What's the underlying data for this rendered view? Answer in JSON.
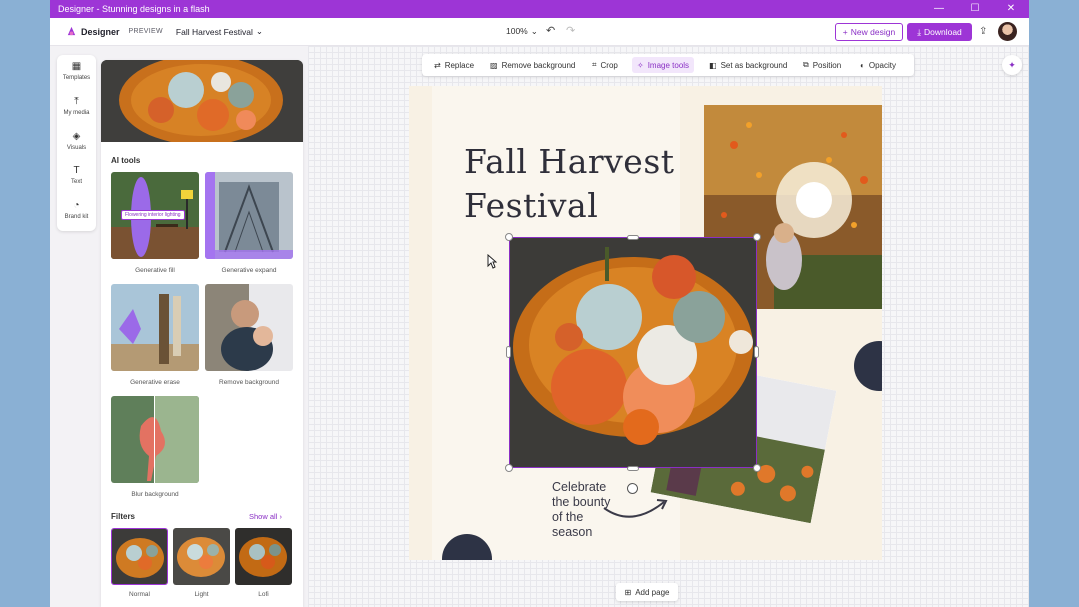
{
  "window": {
    "title": "Designer - Stunning designs in a flash",
    "controls": [
      "—",
      "☐",
      "✕"
    ]
  },
  "header": {
    "brand": "Designer",
    "preview_tag": "PREVIEW",
    "doc_name": "Fall Harvest Festival",
    "zoom": "100%",
    "new_design": "New design",
    "download": "Download"
  },
  "rail": {
    "items": [
      {
        "label": "Templates",
        "icon": "templates-icon"
      },
      {
        "label": "My media",
        "icon": "my-media-icon"
      },
      {
        "label": "Visuals",
        "icon": "visuals-icon"
      },
      {
        "label": "Text",
        "icon": "text-icon"
      },
      {
        "label": "Brand kit",
        "icon": "brand-kit-icon"
      }
    ]
  },
  "panel": {
    "ai_tools_title": "AI tools",
    "fill_badge": "Flowering interior lighting",
    "tools": [
      {
        "label": "Generative fill"
      },
      {
        "label": "Generative expand"
      },
      {
        "label": "Generative erase"
      },
      {
        "label": "Remove background"
      },
      {
        "label": "Blur background"
      }
    ],
    "filters_title": "Filters",
    "see_all": "Show all",
    "filters": [
      {
        "label": "Normal"
      },
      {
        "label": "Light"
      },
      {
        "label": "Lofi"
      }
    ]
  },
  "toolbar": {
    "items": [
      {
        "label": "Replace",
        "icon": "replace-icon"
      },
      {
        "label": "Remove background",
        "icon": "remove-background-icon"
      },
      {
        "label": "Crop",
        "icon": "crop-icon"
      },
      {
        "label": "Image tools",
        "icon": "image-tools-icon"
      },
      {
        "label": "Set as background",
        "icon": "set-background-icon"
      },
      {
        "label": "Position",
        "icon": "position-icon"
      },
      {
        "label": "Opacity",
        "icon": "opacity-icon"
      }
    ],
    "active": "Image tools"
  },
  "design": {
    "title_line1": "Fall Harvest",
    "title_line2": "Festival",
    "tagline": [
      "Celebrate",
      "the bounty",
      "of the",
      "season"
    ]
  },
  "footer": {
    "add_page": "Add page"
  },
  "colors": {
    "accent": "#9d35d6",
    "title_text": "#2f2f3a",
    "navy_disk": "#2d3345"
  }
}
